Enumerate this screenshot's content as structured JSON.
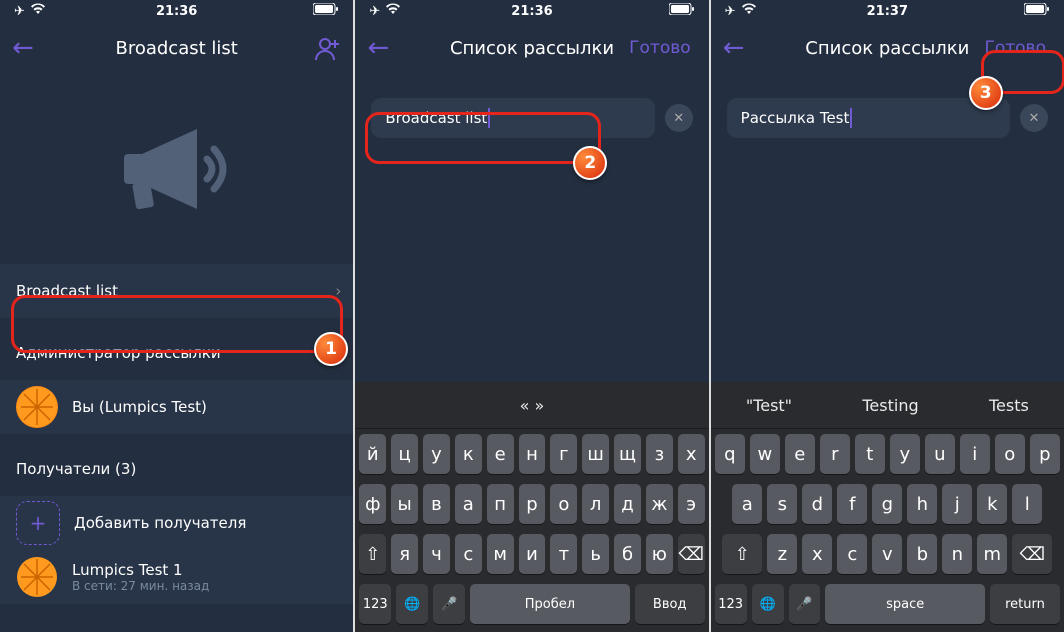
{
  "s1": {
    "time": "21:36",
    "title": "Broadcast list",
    "listName": "Broadcast list",
    "adminHeader": "Администратор рассылки",
    "adminName": "Вы (Lumpics Test)",
    "recipientsHeader": "Получатели (3)",
    "addRecipient": "Добавить получателя",
    "r1name": "Lumpics Test 1",
    "r1sub": "В сети: 27 мин. назад"
  },
  "s2": {
    "time": "21:36",
    "title": "Список рассылки",
    "done": "Готово",
    "input": "Broadcast list",
    "sugg": [
      "«",
      "»"
    ],
    "rows": [
      [
        "й",
        "ц",
        "у",
        "к",
        "е",
        "н",
        "г",
        "ш",
        "щ",
        "з",
        "х"
      ],
      [
        "ф",
        "ы",
        "в",
        "а",
        "п",
        "р",
        "о",
        "л",
        "д",
        "ж",
        "э"
      ],
      [
        "я",
        "ч",
        "с",
        "м",
        "и",
        "т",
        "ь",
        "б",
        "ю"
      ]
    ],
    "bot": {
      "n": "123",
      "space": "Пробел",
      "ret": "Ввод"
    }
  },
  "s3": {
    "time": "21:37",
    "title": "Список рассылки",
    "done": "Готово",
    "input": "Рассылка Test",
    "sugg": [
      "\"Test\"",
      "Testing",
      "Tests"
    ],
    "rows": [
      [
        "q",
        "w",
        "e",
        "r",
        "t",
        "y",
        "u",
        "i",
        "o",
        "p"
      ],
      [
        "a",
        "s",
        "d",
        "f",
        "g",
        "h",
        "j",
        "k",
        "l"
      ],
      [
        "z",
        "x",
        "c",
        "v",
        "b",
        "n",
        "m"
      ]
    ],
    "bot": {
      "n": "123",
      "space": "space",
      "ret": "return"
    }
  },
  "badges": {
    "b1": "1",
    "b2": "2",
    "b3": "3"
  }
}
